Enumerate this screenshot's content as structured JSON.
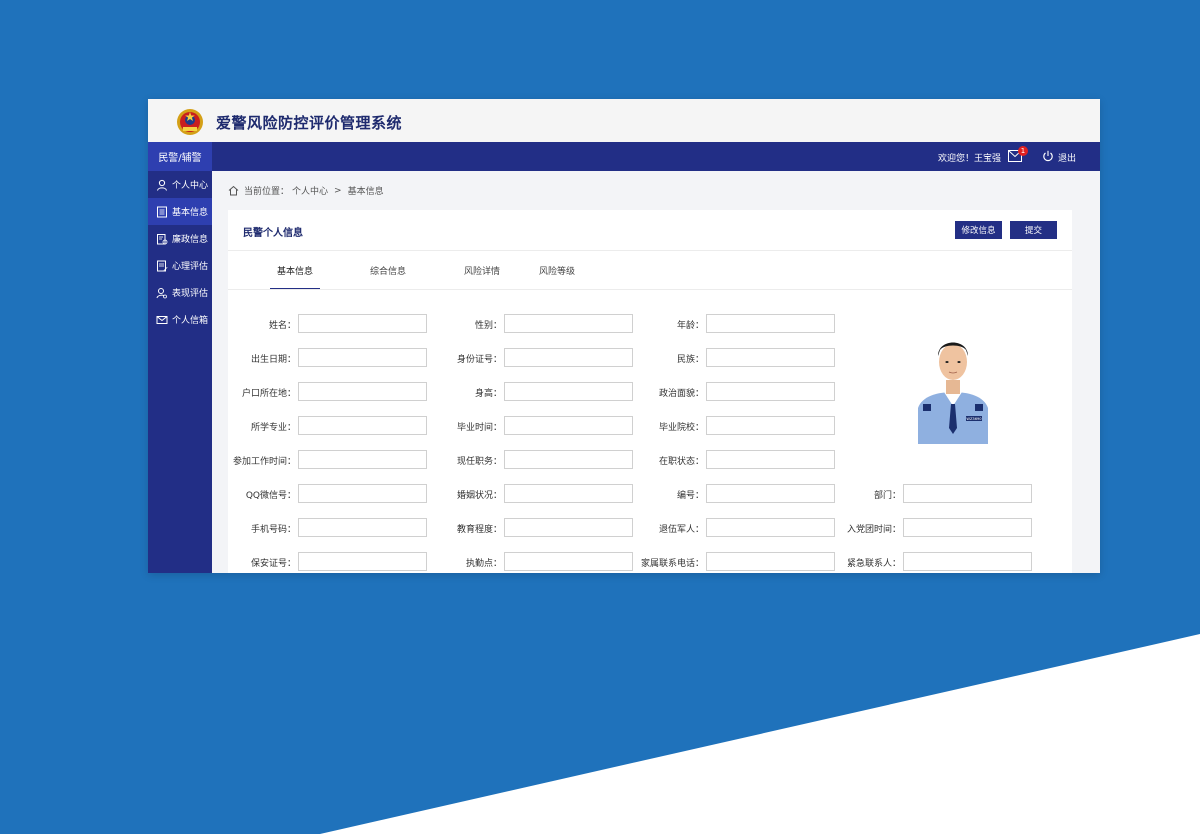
{
  "app": {
    "title": "爱警风险防控评价管理系统",
    "emblem_icon": "police-emblem-icon"
  },
  "colors": {
    "background": "#1f72bb",
    "navy": "#222e86",
    "active": "#2e3fb0",
    "badge": "#e02020"
  },
  "sidebar": {
    "header": "民警/辅警",
    "items": [
      {
        "label": "个人中心",
        "icon": "user-icon",
        "active": false
      },
      {
        "label": "基本信息",
        "icon": "document-icon",
        "active": true
      },
      {
        "label": "廉政信息",
        "icon": "clipboard-icon",
        "active": false
      },
      {
        "label": "心理评估",
        "icon": "edit-list-icon",
        "active": false
      },
      {
        "label": "表现评估",
        "icon": "user-search-icon",
        "active": false
      },
      {
        "label": "个人信箱",
        "icon": "mail-icon",
        "active": false
      }
    ]
  },
  "topbar": {
    "welcome": "欢迎您！王宝强",
    "mail_badge": "1",
    "logout": "退出"
  },
  "breadcrumb": {
    "prefix": "当前位置：",
    "level1": "个人中心",
    "separator": ">",
    "level2": "基本信息"
  },
  "panel": {
    "title": "民警个人信息",
    "edit_button": "修改信息",
    "submit_button": "提交",
    "tabs": [
      "基本信息",
      "综合信息",
      "风险详情",
      "风险等级"
    ],
    "active_tab": 0
  },
  "form": {
    "rows": [
      [
        "姓名：",
        "性别：",
        "年龄："
      ],
      [
        "出生日期：",
        "身份证号：",
        "民族："
      ],
      [
        "户口所在地：",
        "身高：",
        "政治面貌："
      ],
      [
        "所学专业：",
        "毕业时间：",
        "毕业院校："
      ],
      [
        "参加工作时间：",
        "现任职务：",
        "在职状态："
      ],
      [
        "QQ微信号：",
        "婚姻状况：",
        "编号：",
        "部门："
      ],
      [
        "手机号码：",
        "教育程度：",
        "退伍军人：",
        "入党团时间："
      ],
      [
        "保安证号：",
        "执勤点：",
        "家属联系电话：",
        "紧急联系人："
      ]
    ]
  },
  "photo": {
    "badge_text": "WZ3690"
  }
}
